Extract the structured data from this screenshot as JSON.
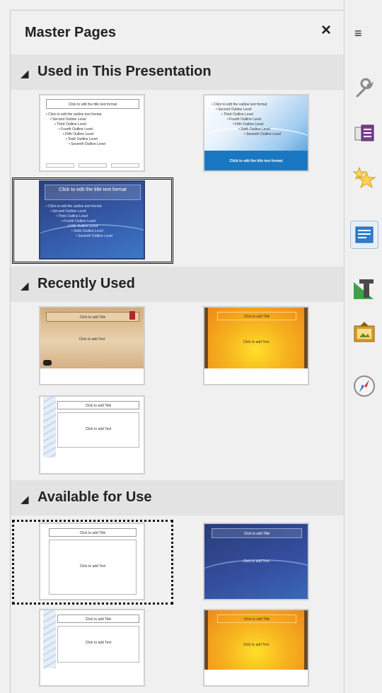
{
  "panel": {
    "title": "Master Pages",
    "close_glyph": "×"
  },
  "sections": [
    {
      "label": "Used in This Presentation",
      "expanded_glyph": "◢",
      "thumbs": [
        {
          "title": "Click to edit the title text format",
          "outline": [
            "• Click to edit the outline text format",
            "• Second Outline Level",
            "• Third Outline Level",
            "• Fourth Outline Level",
            "• Fifth Outline Level",
            "• Sixth Outline Level",
            "• Seventh Outline Level"
          ]
        },
        {
          "title": "Click to edit the title text format",
          "outline": [
            "• Click to edit the outline text format",
            "• Second Outline Level",
            "• Third Outline Level",
            "• Fourth Outline Level",
            "• Fifth Outline Level",
            "• Sixth Outline Level",
            "• Seventh Outline Level"
          ]
        },
        {
          "title": "Click to edit the title text format",
          "outline": [
            "• Click to edit the outline text format",
            "• Second Outline Level",
            "• Third Outline Level",
            "• Fourth Outline Level",
            "• Fifth Outline Level",
            "• Sixth Outline Level",
            "• Seventh Outline Level"
          ]
        }
      ]
    },
    {
      "label": "Recently Used",
      "expanded_glyph": "◢",
      "thumbs": [
        {
          "title": "Click to add Title",
          "body": "Click to add Text"
        },
        {
          "title": "Click to add Title",
          "body": "Click to add Text"
        },
        {
          "title": "Click to add Title",
          "body": "Click to add Text"
        }
      ]
    },
    {
      "label": "Available for Use",
      "expanded_glyph": "◢",
      "thumbs": [
        {
          "title": "Click to add Title",
          "body": "Click to add Text"
        },
        {
          "title": "Click to add Title",
          "body": "Click to add Text"
        },
        {
          "title": "Click to add Title",
          "body": "Click to add Text"
        },
        {
          "title": "Click to add Title",
          "body": "Click to add Text"
        }
      ]
    }
  ],
  "sidebar": {
    "menu_glyph": "≡",
    "buttons": [
      {
        "name": "properties",
        "icon": "wrench-icon"
      },
      {
        "name": "slide-transition",
        "icon": "slide-transition-icon"
      },
      {
        "name": "animation",
        "icon": "star-icon"
      },
      {
        "name": "master-slides",
        "icon": "master-slides-icon"
      },
      {
        "name": "styles",
        "icon": "styles-icon"
      },
      {
        "name": "gallery",
        "icon": "gallery-icon"
      },
      {
        "name": "navigator",
        "icon": "compass-icon"
      }
    ]
  },
  "colors": {
    "panel_bg": "#f0f0f0",
    "section_bg": "#e3e3e3",
    "blue_theme": "#1a78c2",
    "navy_theme": "#2c3f7a",
    "orange_theme": "#f29a1f",
    "tan_theme": "#d9b98c"
  }
}
